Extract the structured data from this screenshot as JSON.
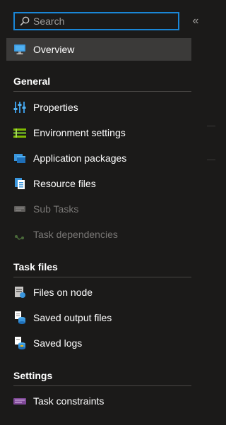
{
  "search": {
    "placeholder": "Search"
  },
  "collapse_icon": "double-chevron-left",
  "overview": {
    "label": "Overview",
    "icon": "monitor-icon"
  },
  "sections": [
    {
      "title": "General",
      "items": [
        {
          "label": "Properties",
          "icon": "sliders-icon",
          "enabled": true
        },
        {
          "label": "Environment settings",
          "icon": "settings-list-icon",
          "enabled": true
        },
        {
          "label": "Application packages",
          "icon": "package-icon",
          "enabled": true
        },
        {
          "label": "Resource files",
          "icon": "files-icon",
          "enabled": true
        },
        {
          "label": "Sub Tasks",
          "icon": "subtasks-icon",
          "enabled": false
        },
        {
          "label": "Task dependencies",
          "icon": "dependencies-icon",
          "enabled": false
        }
      ]
    },
    {
      "title": "Task files",
      "items": [
        {
          "label": "Files on node",
          "icon": "node-files-icon",
          "enabled": true
        },
        {
          "label": "Saved output files",
          "icon": "storage-files-icon",
          "enabled": true
        },
        {
          "label": "Saved logs",
          "icon": "storage-logs-icon",
          "enabled": true
        }
      ]
    },
    {
      "title": "Settings",
      "items": [
        {
          "label": "Task constraints",
          "icon": "constraints-icon",
          "enabled": true
        }
      ]
    }
  ],
  "colors": {
    "background": "#1b1a19",
    "accent": "#1a86d6",
    "active": "#3b3a39",
    "disabled": "#797775"
  }
}
